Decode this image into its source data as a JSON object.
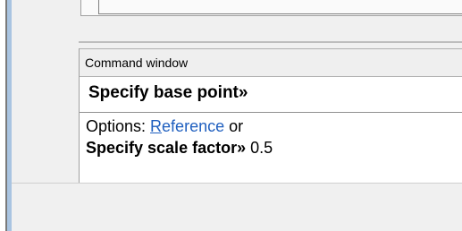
{
  "command_window": {
    "title": "Command window",
    "prompt": "Specify base point»",
    "history": {
      "options_label": "Options: ",
      "option_reference_first": "R",
      "option_reference_rest": "eference",
      "options_suffix": " or",
      "scale_prompt": "Specify scale factor»",
      "scale_value": " 0.5"
    }
  },
  "colors": {
    "link": "#1f5fbf",
    "left_strip": "#a9c4e1",
    "panel_bg": "#f0f0f0"
  }
}
